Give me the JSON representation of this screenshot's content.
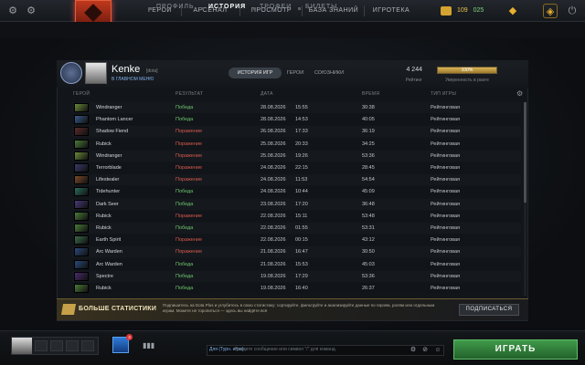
{
  "topbar": {
    "nav": [
      "ГЕРОИ",
      "АРСЕНАЛ",
      "ПРОСМОТР",
      "БАЗА ЗНАНИЙ",
      "ИГРОТЕКА"
    ],
    "currency_gold": "109",
    "currency_shards": "025"
  },
  "subnav": [
    "ПРОФИЛЬ",
    "ИСТОРИЯ",
    "ТРОФЕИ",
    "БИЛЕТЫ"
  ],
  "profile": {
    "name": "Kenke",
    "tag": "[dota]",
    "status": "В ГЛАВНОМ МЕНЮ",
    "tabs": [
      "ИСТОРИЯ ИГР",
      "ГЕРОИ",
      "СОЮЗНИКИ"
    ],
    "rating_value": "4 244",
    "rating_label": "Рейтинг",
    "confidence_pct": "100%",
    "confidence_fraction": 1.0,
    "confidence_label": "Уверенность в ранге"
  },
  "table": {
    "headers": [
      "ГЕРОЙ",
      "РЕЗУЛЬТАТ",
      "ДАТА",
      "ВРЕМЯ",
      "ТИП ИГРЫ"
    ],
    "rows": [
      {
        "hero": "Windranger",
        "result": "Победа",
        "win": true,
        "date": "28.08.2026",
        "time": "15:55",
        "duration": "30:38",
        "type": "Рейтинговая",
        "color": "#6a8a3a"
      },
      {
        "hero": "Phantom Lancer",
        "result": "Победа",
        "win": true,
        "date": "28.08.2026",
        "time": "14:53",
        "duration": "40:05",
        "type": "Рейтинговая",
        "color": "#3a5a8a"
      },
      {
        "hero": "Shadow Fiend",
        "result": "Поражение",
        "win": false,
        "date": "26.08.2026",
        "time": "17:33",
        "duration": "36:19",
        "type": "Рейтинговая",
        "color": "#5a2a2a"
      },
      {
        "hero": "Rubick",
        "result": "Поражение",
        "win": false,
        "date": "25.08.2026",
        "time": "20:33",
        "duration": "34:25",
        "type": "Рейтинговая",
        "color": "#4a7a3a"
      },
      {
        "hero": "Windranger",
        "result": "Поражение",
        "win": false,
        "date": "25.08.2026",
        "time": "19:26",
        "duration": "53:36",
        "type": "Рейтинговая",
        "color": "#6a8a3a"
      },
      {
        "hero": "Terrorblade",
        "result": "Поражение",
        "win": false,
        "date": "24.08.2026",
        "time": "22:15",
        "duration": "28:45",
        "type": "Рейтинговая",
        "color": "#3a3a6a"
      },
      {
        "hero": "Lifestealer",
        "result": "Поражение",
        "win": false,
        "date": "24.08.2026",
        "time": "11:53",
        "duration": "54:54",
        "type": "Рейтинговая",
        "color": "#7a4a2a"
      },
      {
        "hero": "Tidehunter",
        "result": "Победа",
        "win": true,
        "date": "24.08.2026",
        "time": "10:44",
        "duration": "45:09",
        "type": "Рейтинговая",
        "color": "#2a6a5a"
      },
      {
        "hero": "Dark Seer",
        "result": "Победа",
        "win": true,
        "date": "23.08.2026",
        "time": "17:20",
        "duration": "36:48",
        "type": "Рейтинговая",
        "color": "#4a3a7a"
      },
      {
        "hero": "Rubick",
        "result": "Поражение",
        "win": false,
        "date": "22.08.2026",
        "time": "15:11",
        "duration": "53:48",
        "type": "Рейтинговая",
        "color": "#4a7a3a"
      },
      {
        "hero": "Rubick",
        "result": "Победа",
        "win": true,
        "date": "22.08.2026",
        "time": "01:55",
        "duration": "53:31",
        "type": "Рейтинговая",
        "color": "#4a7a3a"
      },
      {
        "hero": "Earth Spirit",
        "result": "Поражение",
        "win": false,
        "date": "22.08.2026",
        "time": "00:15",
        "duration": "43:12",
        "type": "Рейтинговая",
        "color": "#3a6a4a"
      },
      {
        "hero": "Arc Warden",
        "result": "Поражение",
        "win": false,
        "date": "21.08.2026",
        "time": "16:47",
        "duration": "30:50",
        "type": "Рейтинговая",
        "color": "#2a4a7a"
      },
      {
        "hero": "Arc Warden",
        "result": "Победа",
        "win": true,
        "date": "21.08.2026",
        "time": "15:53",
        "duration": "45:03",
        "type": "Рейтинговая",
        "color": "#2a4a7a"
      },
      {
        "hero": "Spectre",
        "result": "Победа",
        "win": true,
        "date": "19.08.2026",
        "time": "17:29",
        "duration": "53:36",
        "type": "Рейтинговая",
        "color": "#4a2a6a"
      },
      {
        "hero": "Rubick",
        "result": "Победа",
        "win": true,
        "date": "19.08.2026",
        "time": "16:40",
        "duration": "26:37",
        "type": "Рейтинговая",
        "color": "#4a7a3a"
      }
    ]
  },
  "promo": {
    "title": "БОЛЬШЕ СТАТИСТИКИ",
    "text": "Подпишитесь на Dota Plus и углубитесь в свою статистику: сортируйте, фильтруйте и анализируйте данные по героям, ролям или отдельным играм. Можете не торопиться — здесь вы найдёте всё",
    "button": "ПОДПИСАТЬСЯ"
  },
  "bottom": {
    "plus_badge": "3",
    "chat_channel": "Для (Турн. игра):",
    "chat_placeholder": "Введите сообщение или символ \"/\" для команд.",
    "play": "ИГРАТЬ"
  },
  "colors": {
    "win": "#6ec46e",
    "loss": "#d8594e",
    "play_button": "#3f9a4a",
    "accent_gold": "#d9b45a"
  },
  "icons": [
    "gear-icon",
    "settings-icon",
    "dota-logo",
    "coin-icon",
    "shield-icon",
    "power-icon",
    "dota-plus-icon",
    "stats-bars-icon",
    "chat-settings-icon",
    "chat-cancel-icon",
    "emoji-icon"
  ]
}
